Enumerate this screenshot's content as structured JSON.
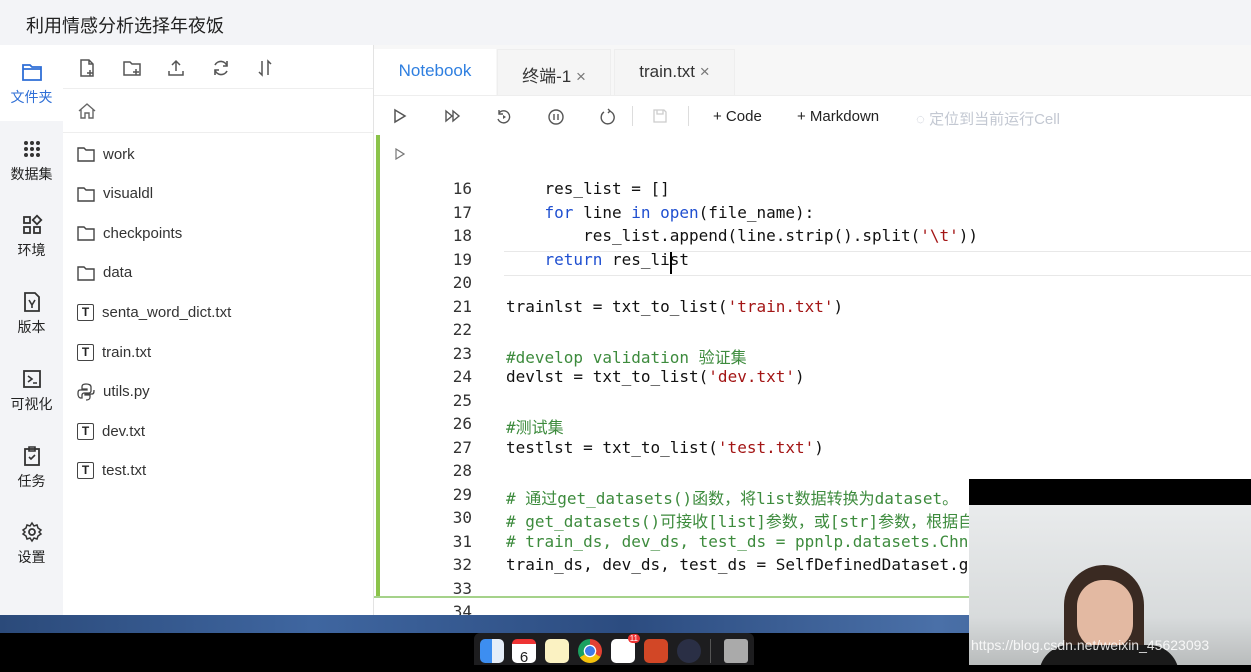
{
  "title": "利用情感分析选择年夜饭",
  "leftnav": [
    {
      "label": "文件夹",
      "icon": "folder-icon",
      "active": true
    },
    {
      "label": "数据集",
      "icon": "dataset-icon"
    },
    {
      "label": "环境",
      "icon": "grid-icon"
    },
    {
      "label": "版本",
      "icon": "version-icon"
    },
    {
      "label": "可视化",
      "icon": "terminal-icon"
    },
    {
      "label": "任务",
      "icon": "clipboard-icon"
    },
    {
      "label": "设置",
      "icon": "gear-icon"
    }
  ],
  "files": [
    {
      "name": "work",
      "type": "folder"
    },
    {
      "name": "visualdl",
      "type": "folder"
    },
    {
      "name": "checkpoints",
      "type": "folder"
    },
    {
      "name": "data",
      "type": "folder"
    },
    {
      "name": "senta_word_dict.txt",
      "type": "txt"
    },
    {
      "name": "train.txt",
      "type": "txt"
    },
    {
      "name": "utils.py",
      "type": "py"
    },
    {
      "name": "dev.txt",
      "type": "txt"
    },
    {
      "name": "test.txt",
      "type": "txt"
    }
  ],
  "tabs": [
    {
      "label": "Notebook",
      "active": true
    },
    {
      "label": "终端-1",
      "close": "×"
    },
    {
      "label": "train.txt",
      "close": "×"
    }
  ],
  "toolbar": {
    "add_code": "+ Code",
    "add_markdown": "+ Markdown",
    "locate": "定位到当前运行Cell"
  },
  "code_lines": [
    {
      "n": "16",
      "t": [
        [
          "    res_list = []",
          ""
        ]
      ]
    },
    {
      "n": "17",
      "t": [
        [
          "    ",
          ""
        ],
        [
          "for",
          "kw"
        ],
        [
          " line ",
          ""
        ],
        [
          "in",
          "kw"
        ],
        [
          " ",
          ""
        ],
        [
          "open",
          "kw"
        ],
        [
          "(file_name):",
          ""
        ]
      ]
    },
    {
      "n": "18",
      "t": [
        [
          "        res_list.append(line.strip().split(",
          ""
        ],
        [
          "'\\t'",
          "st"
        ],
        [
          "))",
          ""
        ]
      ]
    },
    {
      "n": "19",
      "t": [
        [
          "    ",
          ""
        ],
        [
          "return",
          "kw"
        ],
        [
          " res_list",
          ""
        ]
      ]
    },
    {
      "n": "20",
      "t": []
    },
    {
      "n": "21",
      "t": [
        [
          "trainlst = txt_to_list(",
          ""
        ],
        [
          "'train.txt'",
          "st"
        ],
        [
          ")",
          ""
        ]
      ]
    },
    {
      "n": "22",
      "t": []
    },
    {
      "n": "23",
      "t": [
        [
          "#develop validation 验证集",
          "cm"
        ]
      ]
    },
    {
      "n": "24",
      "t": [
        [
          "devlst = txt_to_list(",
          ""
        ],
        [
          "'dev.txt'",
          "st"
        ],
        [
          ")",
          ""
        ]
      ]
    },
    {
      "n": "25",
      "t": []
    },
    {
      "n": "26",
      "t": [
        [
          "#测试集",
          "cm"
        ]
      ]
    },
    {
      "n": "27",
      "t": [
        [
          "testlst = txt_to_list(",
          ""
        ],
        [
          "'test.txt'",
          "st"
        ],
        [
          ")",
          ""
        ]
      ]
    },
    {
      "n": "28",
      "t": []
    },
    {
      "n": "29",
      "t": [
        [
          "# 通过get_datasets()函数，将list数据转换为dataset。",
          "cm"
        ]
      ]
    },
    {
      "n": "30",
      "t": [
        [
          "# get_datasets()可接收[list]参数，或[str]参数，根据自定义数据集的写法自由选择。",
          "cm"
        ]
      ]
    },
    {
      "n": "31",
      "t": [
        [
          "# train_ds, dev_ds, test_ds = ppnlp.datasets.Chn",
          "cm"
        ]
      ]
    },
    {
      "n": "32",
      "t": [
        [
          "train_ds, dev_ds, test_ds = SelfDefinedDataset.g",
          ""
        ]
      ]
    },
    {
      "n": "33",
      "t": []
    },
    {
      "n": "34",
      "t": []
    }
  ],
  "watermark": "https://blog.csdn.net/weixin_45623093",
  "dock": {
    "calendar_day": "6",
    "badge": "11"
  },
  "colors": {
    "accent": "#2f7fe0",
    "cell_bar": "#8bc34a",
    "keyword": "#1f4fd0",
    "string": "#a31515",
    "comment": "#3d8b3d"
  }
}
